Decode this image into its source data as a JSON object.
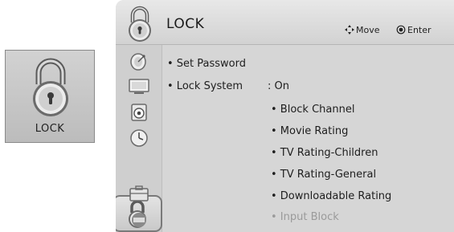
{
  "tile": {
    "label": "LOCK",
    "icon": "padlock-icon"
  },
  "header": {
    "title": "LOCK",
    "move_icon": "move-arrows-icon",
    "move_label": "Move",
    "enter_icon": "enter-circle-icon",
    "enter_label": "Enter"
  },
  "sidebar": {
    "items": [
      {
        "icon": "satellite-dish-icon"
      },
      {
        "icon": "tv-screen-icon"
      },
      {
        "icon": "speaker-icon"
      },
      {
        "icon": "clock-icon"
      },
      {
        "icon": "lock-icon",
        "selected": true
      },
      {
        "icon": "toolbox-icon"
      },
      {
        "icon": "network-icon"
      }
    ]
  },
  "menu": {
    "set_password": "• Set Password",
    "lock_system": "• Lock System",
    "lock_system_value": ": On",
    "sub_items": [
      "• Block Channel",
      "• Movie Rating",
      "• TV Rating-Children",
      "• TV Rating-General",
      "• Downloadable Rating",
      "• Input Block"
    ]
  }
}
